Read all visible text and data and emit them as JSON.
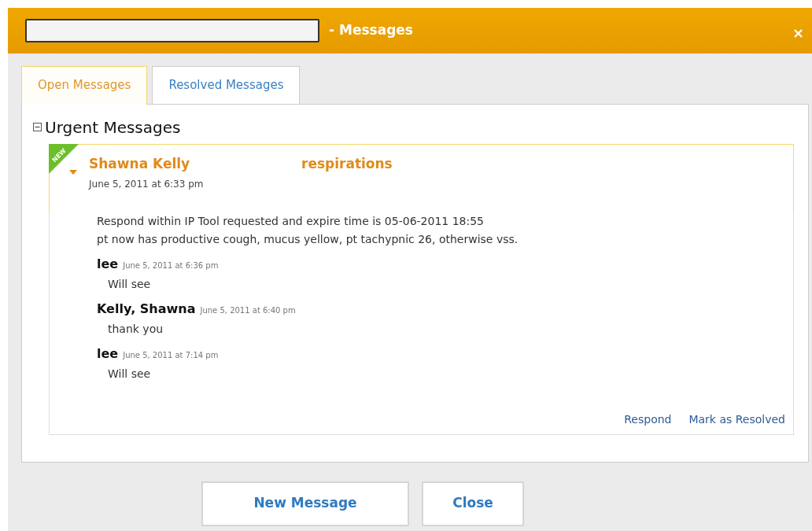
{
  "window": {
    "title": "- Messages",
    "close": "×"
  },
  "tabs": [
    {
      "label": "Open Messages",
      "selected": true
    },
    {
      "label": "Resolved Messages",
      "selected": false
    }
  ],
  "section": {
    "title": "Urgent Messages",
    "expanded": true
  },
  "message": {
    "badge": "NEW",
    "expanded": true,
    "sender": "Shawna Kelly",
    "subject": "respirations",
    "time": "June 5, 2011 at 6:33 pm",
    "body": [
      "Respond within IP Tool requested and expire time is 05-06-2011 18:55",
      "pt now has productive cough, mucus yellow, pt tachypnic 26, otherwise vss."
    ],
    "replies": [
      {
        "author": "lee",
        "time": "June 5, 2011 at 6:36 pm",
        "text": "Will see"
      },
      {
        "author": "Kelly, Shawna",
        "time": "June 5, 2011 at 6:40 pm",
        "text": "thank you"
      },
      {
        "author": "lee",
        "time": "June 5, 2011 at 7:14 pm",
        "text": "Will see"
      }
    ],
    "actions": [
      "Respond",
      "Mark as Resolved"
    ]
  },
  "buttons": [
    "New Message",
    "Close"
  ]
}
